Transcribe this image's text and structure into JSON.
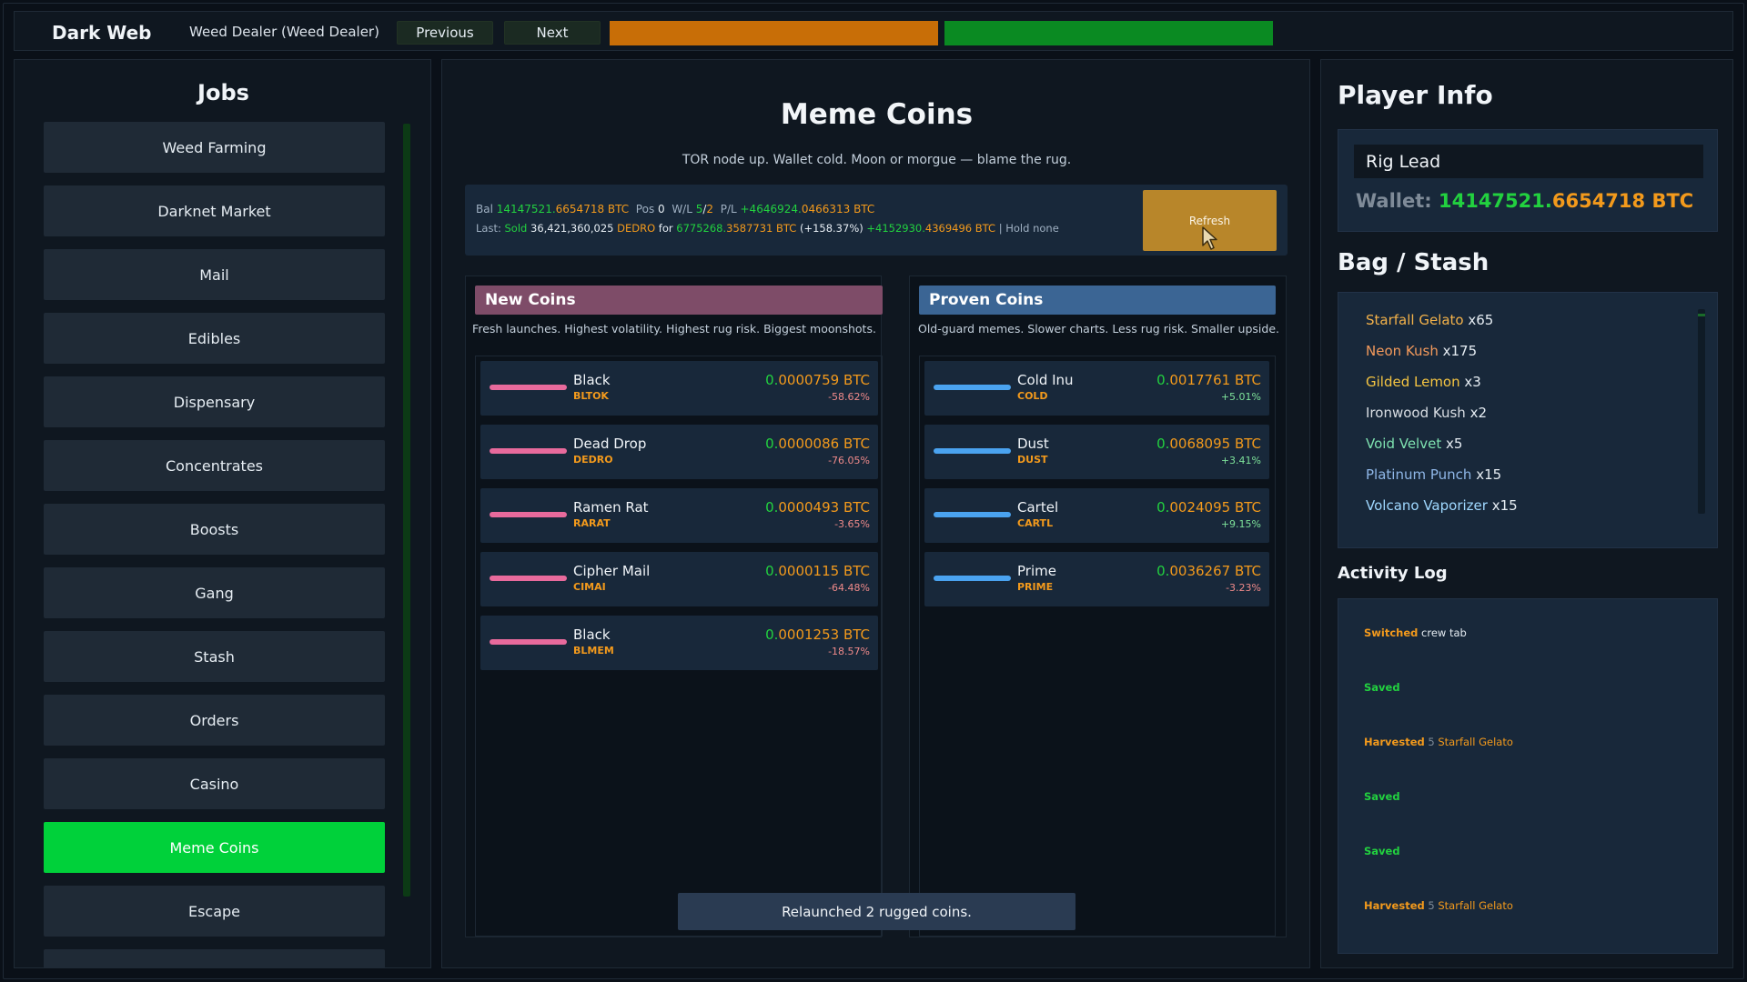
{
  "topbar": {
    "brand": "Dark Web",
    "crumb": "Weed Dealer (Weed Dealer)",
    "prev_label": "Previous",
    "next_label": "Next",
    "colors": {
      "orange_bar": "#c86e07",
      "green_bar": "#0a8a22"
    }
  },
  "jobs": {
    "title": "Jobs",
    "items": [
      {
        "label": "Weed Farming"
      },
      {
        "label": "Darknet Market"
      },
      {
        "label": "Mail"
      },
      {
        "label": "Edibles"
      },
      {
        "label": "Dispensary"
      },
      {
        "label": "Concentrates"
      },
      {
        "label": "Boosts"
      },
      {
        "label": "Gang"
      },
      {
        "label": "Stash"
      },
      {
        "label": "Orders"
      },
      {
        "label": "Casino"
      },
      {
        "label": "Meme Coins"
      },
      {
        "label": "Escape"
      }
    ],
    "active": "Meme Coins"
  },
  "main": {
    "title": "Meme Coins",
    "subtitle": "TOR node up. Wallet cold. Moon or morgue — blame the rug.",
    "stats": {
      "bal_label": "Bal",
      "bal_lead": "14147521.",
      "bal_tail": "6654718 BTC",
      "pos_label": "Pos",
      "pos_value": "0",
      "wl_label": "W/L",
      "wl_w": "5",
      "wl_sep": "/",
      "wl_l": "2",
      "pl_label": "P/L",
      "pl_lead": "+4646924.",
      "pl_tail": "0466313 BTC",
      "last_label": "Last:",
      "last_sold": "Sold",
      "last_qty": "36,421,360,025",
      "last_sym": "DEDRO",
      "last_for": "for",
      "last_amt_lead": "6775268.",
      "last_amt_tail": "3587731 BTC",
      "last_pct": "(+158.37%)",
      "last_profit_lead": "+4152930.",
      "last_profit_tail": "4369496 BTC",
      "last_sep": "|",
      "hold": "Hold none"
    },
    "refresh_label": "Refresh",
    "new_coins": {
      "title": "New Coins",
      "desc": "Fresh launches. Highest volatility. Highest rug risk. Biggest moonshots.",
      "items": [
        {
          "name": "Black",
          "sym": "BLTOK",
          "price_lead": "0.",
          "price_tail": "0000759 BTC",
          "change": "-58.62%"
        },
        {
          "name": "Dead Drop",
          "sym": "DEDRO",
          "price_lead": "0.",
          "price_tail": "0000086 BTC",
          "change": "-76.05%"
        },
        {
          "name": "Ramen Rat",
          "sym": "RARAT",
          "price_lead": "0.",
          "price_tail": "0000493 BTC",
          "change": "-3.65%"
        },
        {
          "name": "Cipher Mail",
          "sym": "CIMAI",
          "price_lead": "0.",
          "price_tail": "0000115 BTC",
          "change": "-64.48%"
        },
        {
          "name": "Black",
          "sym": "BLMEM",
          "price_lead": "0.",
          "price_tail": "0001253 BTC",
          "change": "-18.57%"
        }
      ]
    },
    "proven_coins": {
      "title": "Proven Coins",
      "desc": "Old-guard memes. Slower charts. Less rug risk. Smaller upside.",
      "items": [
        {
          "name": "Cold Inu",
          "sym": "COLD",
          "price_lead": "0.",
          "price_tail": "0017761 BTC",
          "change": "+5.01%"
        },
        {
          "name": "Dust",
          "sym": "DUST",
          "price_lead": "0.",
          "price_tail": "0068095 BTC",
          "change": "+3.41%"
        },
        {
          "name": "Cartel",
          "sym": "CARTL",
          "price_lead": "0.",
          "price_tail": "0024095 BTC",
          "change": "+9.15%"
        },
        {
          "name": "Prime",
          "sym": "PRIME",
          "price_lead": "0.",
          "price_tail": "0036267 BTC",
          "change": "-3.23%"
        }
      ]
    },
    "toast": "Relaunched 2 rugged coins."
  },
  "player": {
    "title": "Player Info",
    "role": "Rig Lead",
    "wallet_label": "Wallet:",
    "wallet_lead": "14147521.",
    "wallet_tail": "6654718 BTC"
  },
  "stash": {
    "title": "Bag / Stash",
    "items": [
      {
        "name": "Starfall Gelato",
        "qty": "x65",
        "color": "#f3b24a"
      },
      {
        "name": "Neon Kush",
        "qty": "x175",
        "color": "#f39a5c"
      },
      {
        "name": "Gilded Lemon",
        "qty": "x3",
        "color": "#f5c542"
      },
      {
        "name": "Ironwood Kush",
        "qty": "x2",
        "color": "#d9dee4"
      },
      {
        "name": "Void Velvet",
        "qty": "x5",
        "color": "#7ee2b0"
      },
      {
        "name": "Platinum Punch",
        "qty": "x15",
        "color": "#8fb7e8"
      },
      {
        "name": "Volcano Vaporizer",
        "qty": "x15",
        "color": "#9fd8ff"
      }
    ]
  },
  "activity": {
    "title": "Activity Log",
    "items": [
      {
        "kw": "Switched",
        "rest": "crew tab"
      },
      {
        "kw": "Saved",
        "rest": ""
      },
      {
        "kw": "Harvested",
        "num": "5",
        "rest": "Starfall Gelato"
      },
      {
        "kw": "Saved",
        "rest": ""
      },
      {
        "kw": "Saved",
        "rest": ""
      },
      {
        "kw": "Harvested",
        "num": "5",
        "rest": "Starfall Gelato"
      }
    ]
  }
}
